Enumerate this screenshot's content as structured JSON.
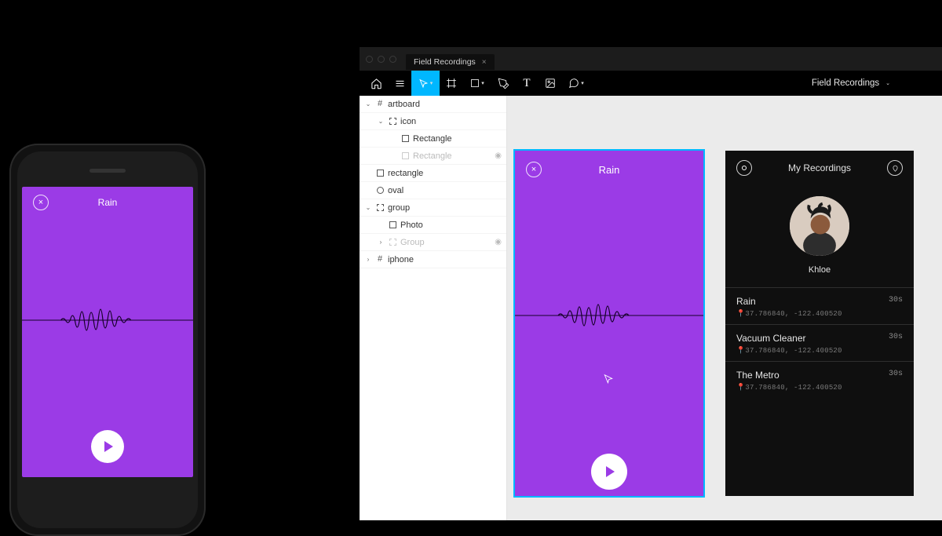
{
  "app": {
    "tab_label": "Field Recordings",
    "doc_title": "Field Recordings"
  },
  "layers": [
    {
      "indent": 0,
      "chevron": "down",
      "icon": "frame",
      "name": "artboard",
      "dim": false,
      "eye": false
    },
    {
      "indent": 1,
      "chevron": "down",
      "icon": "group",
      "name": "icon",
      "dim": false,
      "eye": false
    },
    {
      "indent": 2,
      "chevron": "",
      "icon": "rect",
      "name": "Rectangle",
      "dim": false,
      "eye": false
    },
    {
      "indent": 2,
      "chevron": "",
      "icon": "rect",
      "name": "Rectangle",
      "dim": true,
      "eye": true
    },
    {
      "indent": 0,
      "chevron": "",
      "icon": "rect",
      "name": "rectangle",
      "dim": false,
      "eye": false
    },
    {
      "indent": 0,
      "chevron": "",
      "icon": "circle",
      "name": "oval",
      "dim": false,
      "eye": false
    },
    {
      "indent": 0,
      "chevron": "down",
      "icon": "group",
      "name": "group",
      "dim": false,
      "eye": false
    },
    {
      "indent": 1,
      "chevron": "",
      "icon": "rect",
      "name": "Photo",
      "dim": false,
      "eye": false
    },
    {
      "indent": 1,
      "chevron": "right",
      "icon": "group",
      "name": "Group",
      "dim": true,
      "eye": true
    },
    {
      "indent": 0,
      "chevron": "right",
      "icon": "frame",
      "name": "iphone",
      "dim": false,
      "eye": false
    }
  ],
  "rain_screen": {
    "title": "Rain",
    "close_glyph": "×"
  },
  "recordings": {
    "header": "My Recordings",
    "user": "Khloe",
    "tracks": [
      {
        "title": "Rain",
        "duration": "30s",
        "geo": "37.786840, -122.400520"
      },
      {
        "title": "Vacuum Cleaner",
        "duration": "30s",
        "geo": "37.786840, -122.400520"
      },
      {
        "title": "The Metro",
        "duration": "30s",
        "geo": "37.786840, -122.400520"
      }
    ]
  }
}
